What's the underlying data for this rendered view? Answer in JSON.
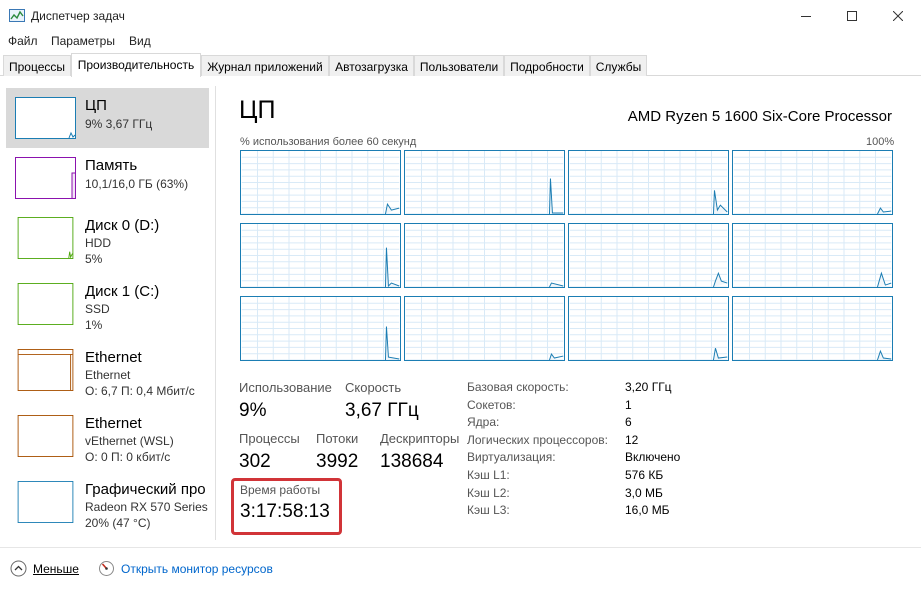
{
  "window": {
    "title": "Диспетчер задач",
    "icon": "task-manager-icon"
  },
  "menu": [
    "Файл",
    "Параметры",
    "Вид"
  ],
  "tabs": [
    {
      "label": "Процессы",
      "active": false
    },
    {
      "label": "Производительность",
      "active": true
    },
    {
      "label": "Журнал приложений",
      "active": false
    },
    {
      "label": "Автозагрузка",
      "active": false
    },
    {
      "label": "Пользователи",
      "active": false
    },
    {
      "label": "Подробности",
      "active": false
    },
    {
      "label": "Службы",
      "active": false
    }
  ],
  "sidebar": {
    "items": [
      {
        "name": "ЦП",
        "line1": "9% 3,67 ГГц",
        "line2": "",
        "color": "#1b7db3",
        "selected": true
      },
      {
        "name": "Память",
        "line1": "10,1/16,0 ГБ (63%)",
        "line2": "",
        "color": "#8b12ae",
        "selected": false
      },
      {
        "name": "Диск 0 (D:)",
        "line1": "HDD",
        "line2": "5%",
        "color": "#4da60c",
        "selected": false
      },
      {
        "name": "Диск 1 (C:)",
        "line1": "SSD",
        "line2": "1%",
        "color": "#4da60c",
        "selected": false
      },
      {
        "name": "Ethernet",
        "line1": "Ethernet",
        "line2": "О: 6,7  П: 0,4 Мбит/с",
        "color": "#a74f01",
        "selected": false
      },
      {
        "name": "Ethernet",
        "line1": "vEthernet (WSL)",
        "line2": "О: 0  П: 0 кбит/с",
        "color": "#a74f01",
        "selected": false
      },
      {
        "name": "Графический про",
        "line1": "Radeon RX 570 Series",
        "line2": "20%  (47 °C)",
        "color": "#1b7db3",
        "selected": false
      }
    ]
  },
  "main": {
    "title": "ЦП",
    "processor": "AMD Ryzen 5 1600 Six-Core Processor",
    "graph_caption": "% использования более 60 секунд",
    "graph_max": "100%",
    "stats": {
      "usage_label": "Использование",
      "usage_value": "9%",
      "speed_label": "Скорость",
      "speed_value": "3,67 ГГц",
      "processes_label": "Процессы",
      "processes_value": "302",
      "threads_label": "Потоки",
      "threads_value": "3992",
      "handles_label": "Дескрипторы",
      "handles_value": "138684",
      "uptime_label": "Время работы",
      "uptime_value": "3:17:58:13"
    },
    "details": [
      {
        "key": "Базовая скорость:",
        "value": "3,20 ГГц"
      },
      {
        "key": "Сокетов:",
        "value": "1"
      },
      {
        "key": "Ядра:",
        "value": "6"
      },
      {
        "key": "Логических процессоров:",
        "value": "12"
      },
      {
        "key": "Виртуализация:",
        "value": "Включено"
      },
      {
        "key": "Кэш L1:",
        "value": "576 КБ"
      },
      {
        "key": "Кэш L2:",
        "value": "3,0 МБ"
      },
      {
        "key": "Кэш L3:",
        "value": "16,0 МБ"
      }
    ]
  },
  "footer": {
    "less_label": "Меньше",
    "monitor_label": "Открыть монитор ресурсов"
  },
  "colors": {
    "cpu": "#1b7db3",
    "memory": "#8b12ae",
    "disk": "#4da60c",
    "ethernet": "#a74f01",
    "highlight": "#d13438",
    "link": "#0066cc"
  }
}
